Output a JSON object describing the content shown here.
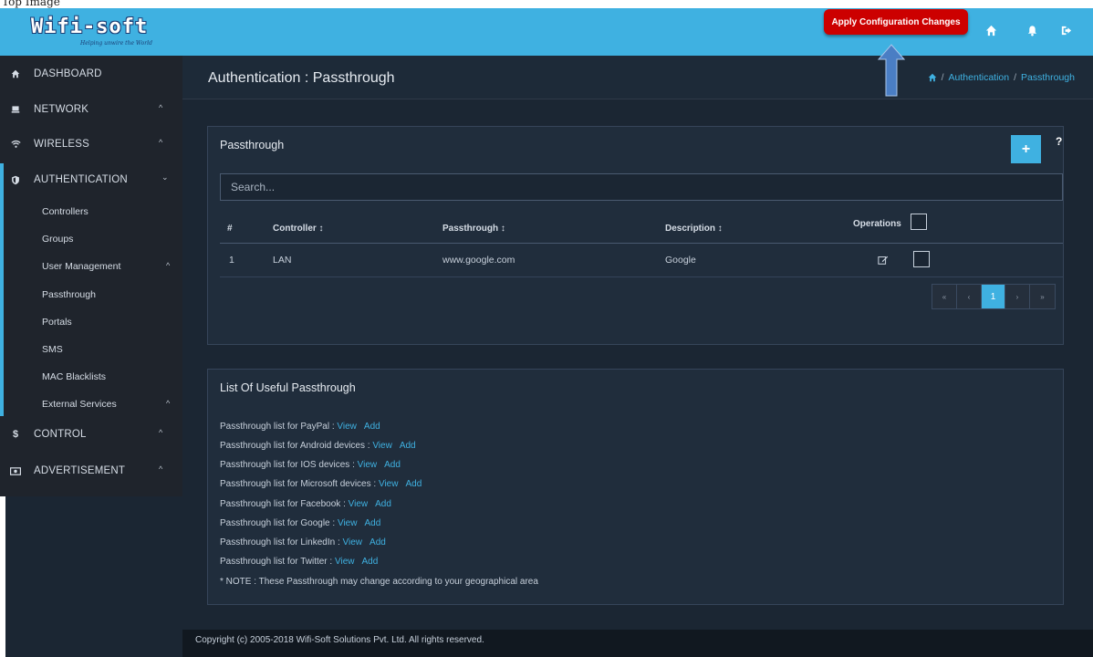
{
  "top_strip_text": "Top Image",
  "header": {
    "logo_text": "Wifi-soft",
    "logo_tagline": "Helping unwire the World",
    "apply_button": "Apply Configuration Changes",
    "icons": [
      "home-icon",
      "bell-icon",
      "logout-icon"
    ]
  },
  "sidebar": {
    "items": [
      {
        "label": "DASHBOARD",
        "icon": "home-icon"
      },
      {
        "label": "NETWORK",
        "icon": "monitor-icon"
      },
      {
        "label": "WIRELESS",
        "icon": "wifi-icon"
      },
      {
        "label": "AUTHENTICATION",
        "icon": "shield-icon"
      },
      {
        "label": "CONTROL",
        "icon": "dollar-icon"
      },
      {
        "label": "ADVERTISEMENT",
        "icon": "money-icon"
      }
    ],
    "auth_subitems": [
      {
        "label": "Controllers"
      },
      {
        "label": "Groups"
      },
      {
        "label": "User Management"
      },
      {
        "label": "Passthrough"
      },
      {
        "label": "Portals"
      },
      {
        "label": "SMS"
      },
      {
        "label": "MAC Blacklists"
      },
      {
        "label": "External Services"
      }
    ]
  },
  "page": {
    "title": "Authentication : Passthrough",
    "breadcrumb": [
      "Authentication",
      "Passthrough"
    ]
  },
  "passthrough_panel": {
    "title": "Passthrough",
    "add_label": "+",
    "help_label": "?",
    "search_placeholder": "Search...",
    "columns": [
      "#",
      "Controller ↕",
      "Passthrough ↕",
      "Description ↕",
      "Operations"
    ],
    "rows": [
      {
        "num": "1",
        "controller": "LAN",
        "passthrough": "www.google.com",
        "description": "Google"
      }
    ],
    "pager": {
      "first": "«",
      "prev": "‹",
      "current": "1",
      "next": "›",
      "last": "»"
    }
  },
  "useful_panel": {
    "title": "List Of Useful Passthrough",
    "view_label": "View",
    "add_label": "Add",
    "items": [
      "Passthrough list for PayPal :",
      "Passthrough list for Android devices :",
      "Passthrough list for IOS devices :",
      "Passthrough list for Microsoft devices :",
      "Passthrough list for Facebook :",
      "Passthrough list for Google :",
      "Passthrough list for LinkedIn :",
      "Passthrough list for Twitter :"
    ],
    "note": "* NOTE : These Passthrough may change according to your geographical area"
  },
  "footer": {
    "copyright": "Copyright (c) 2005-2018 Wifi-Soft Solutions Pvt. Ltd. All rights reserved."
  },
  "colors": {
    "accent": "#3fb1e1",
    "apply_red": "#cc0000",
    "sidebar_bg": "#1f242c",
    "content_bg": "#1b2633"
  }
}
